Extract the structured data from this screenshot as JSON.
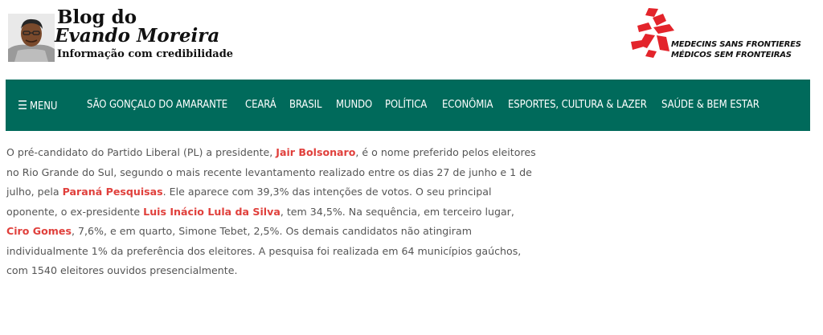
{
  "header": {
    "blog_title_line1": "Blog do",
    "blog_title_line2": "Evando Moreira",
    "tagline": "Informação com credibilidade",
    "msf": {
      "line1": "MEDECINS SANS FRONTIERES",
      "line2": "MÉDICOS SEM FRONTEIRAS",
      "brand_color": "#e3242b"
    }
  },
  "nav": {
    "background": "#006a5b",
    "menu_icon": "hamburger-icon",
    "menu_label": "MENU",
    "items": [
      "SÃO GONÇALO DO AMARANTE",
      "CEARÁ",
      "BRASIL",
      "MUNDO",
      "POLÍTICA",
      "ECONÔMIA",
      "ESPORTES, CULTURA & LAZER",
      "SAÚDE & BEM ESTAR"
    ]
  },
  "article": {
    "link_color": "#e0403c",
    "text_color": "#555555",
    "t1": "O pré-candidato do Partido Liberal (PL) a presidente, ",
    "link1": "Jair Bolsonaro",
    "t2": ", é o nome preferido pelos eleitores no Rio Grande do Sul, segundo o mais recente levantamento realizado entre os dias 27 de junho e 1 de julho, pela ",
    "link2": "Paraná Pesquisas",
    "t3": ". Ele aparece com 39,3% das intenções de votos. O seu principal oponente, o ex-presidente ",
    "link3": "Luis Inácio Lula da Silva",
    "t4": ", tem 34,5%. Na sequência, em terceiro lugar, ",
    "link4": "Ciro Gomes",
    "t5": ", 7,6%, e em quarto, Simone Tebet, 2,5%. Os demais candidatos não atingiram individualmente 1% da preferência dos eleitores. A pesquisa foi realizada em 64 municípios gaúchos, com 1540 eleitores ouvidos presencialmente."
  }
}
